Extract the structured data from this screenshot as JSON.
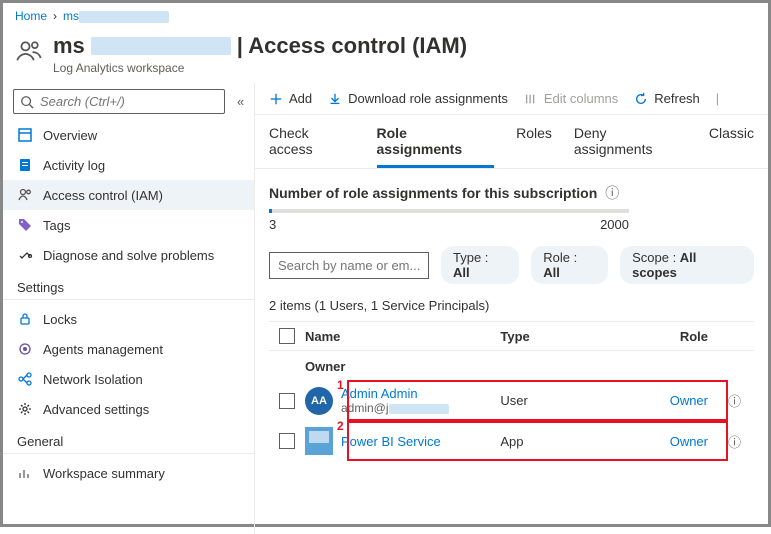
{
  "breadcrumb": {
    "home": "Home",
    "current_prefix": "ms"
  },
  "header": {
    "title_prefix": "ms",
    "title_suffix": " | Access control (IAM)",
    "subtitle": "Log Analytics workspace"
  },
  "search": {
    "placeholder": "Search (Ctrl+/)"
  },
  "sidebar": {
    "items": [
      {
        "label": "Overview"
      },
      {
        "label": "Activity log"
      },
      {
        "label": "Access control (IAM)"
      },
      {
        "label": "Tags"
      },
      {
        "label": "Diagnose and solve problems"
      }
    ],
    "settings_header": "Settings",
    "settings_items": [
      {
        "label": "Locks"
      },
      {
        "label": "Agents management"
      },
      {
        "label": "Network Isolation"
      },
      {
        "label": "Advanced settings"
      }
    ],
    "general_header": "General",
    "general_items": [
      {
        "label": "Workspace summary"
      }
    ]
  },
  "toolbar": {
    "add": "Add",
    "download": "Download role assignments",
    "edit": "Edit columns",
    "refresh": "Refresh"
  },
  "tabs": {
    "check": "Check access",
    "role_assignments": "Role assignments",
    "roles": "Roles",
    "deny": "Deny assignments",
    "classic": "Classic"
  },
  "quota": {
    "label": "Number of role assignments for this subscription",
    "used": "3",
    "max": "2000"
  },
  "filters": {
    "search_placeholder": "Search by name or em...",
    "type_label": "Type : ",
    "type_value": "All",
    "role_label": "Role : ",
    "role_value": "All",
    "scope_label": "Scope : ",
    "scope_value": "All scopes"
  },
  "items_count": "2 items (1 Users, 1 Service Principals)",
  "columns": {
    "name": "Name",
    "type": "Type",
    "role": "Role"
  },
  "group": {
    "owner": "Owner"
  },
  "rows": [
    {
      "avatar_initials": "AA",
      "name": "Admin Admin",
      "sub_prefix": "admin@j",
      "type": "User",
      "role": "Owner",
      "marker": "1"
    },
    {
      "name": "Power BI Service",
      "type": "App",
      "role": "Owner",
      "marker": "2"
    }
  ]
}
